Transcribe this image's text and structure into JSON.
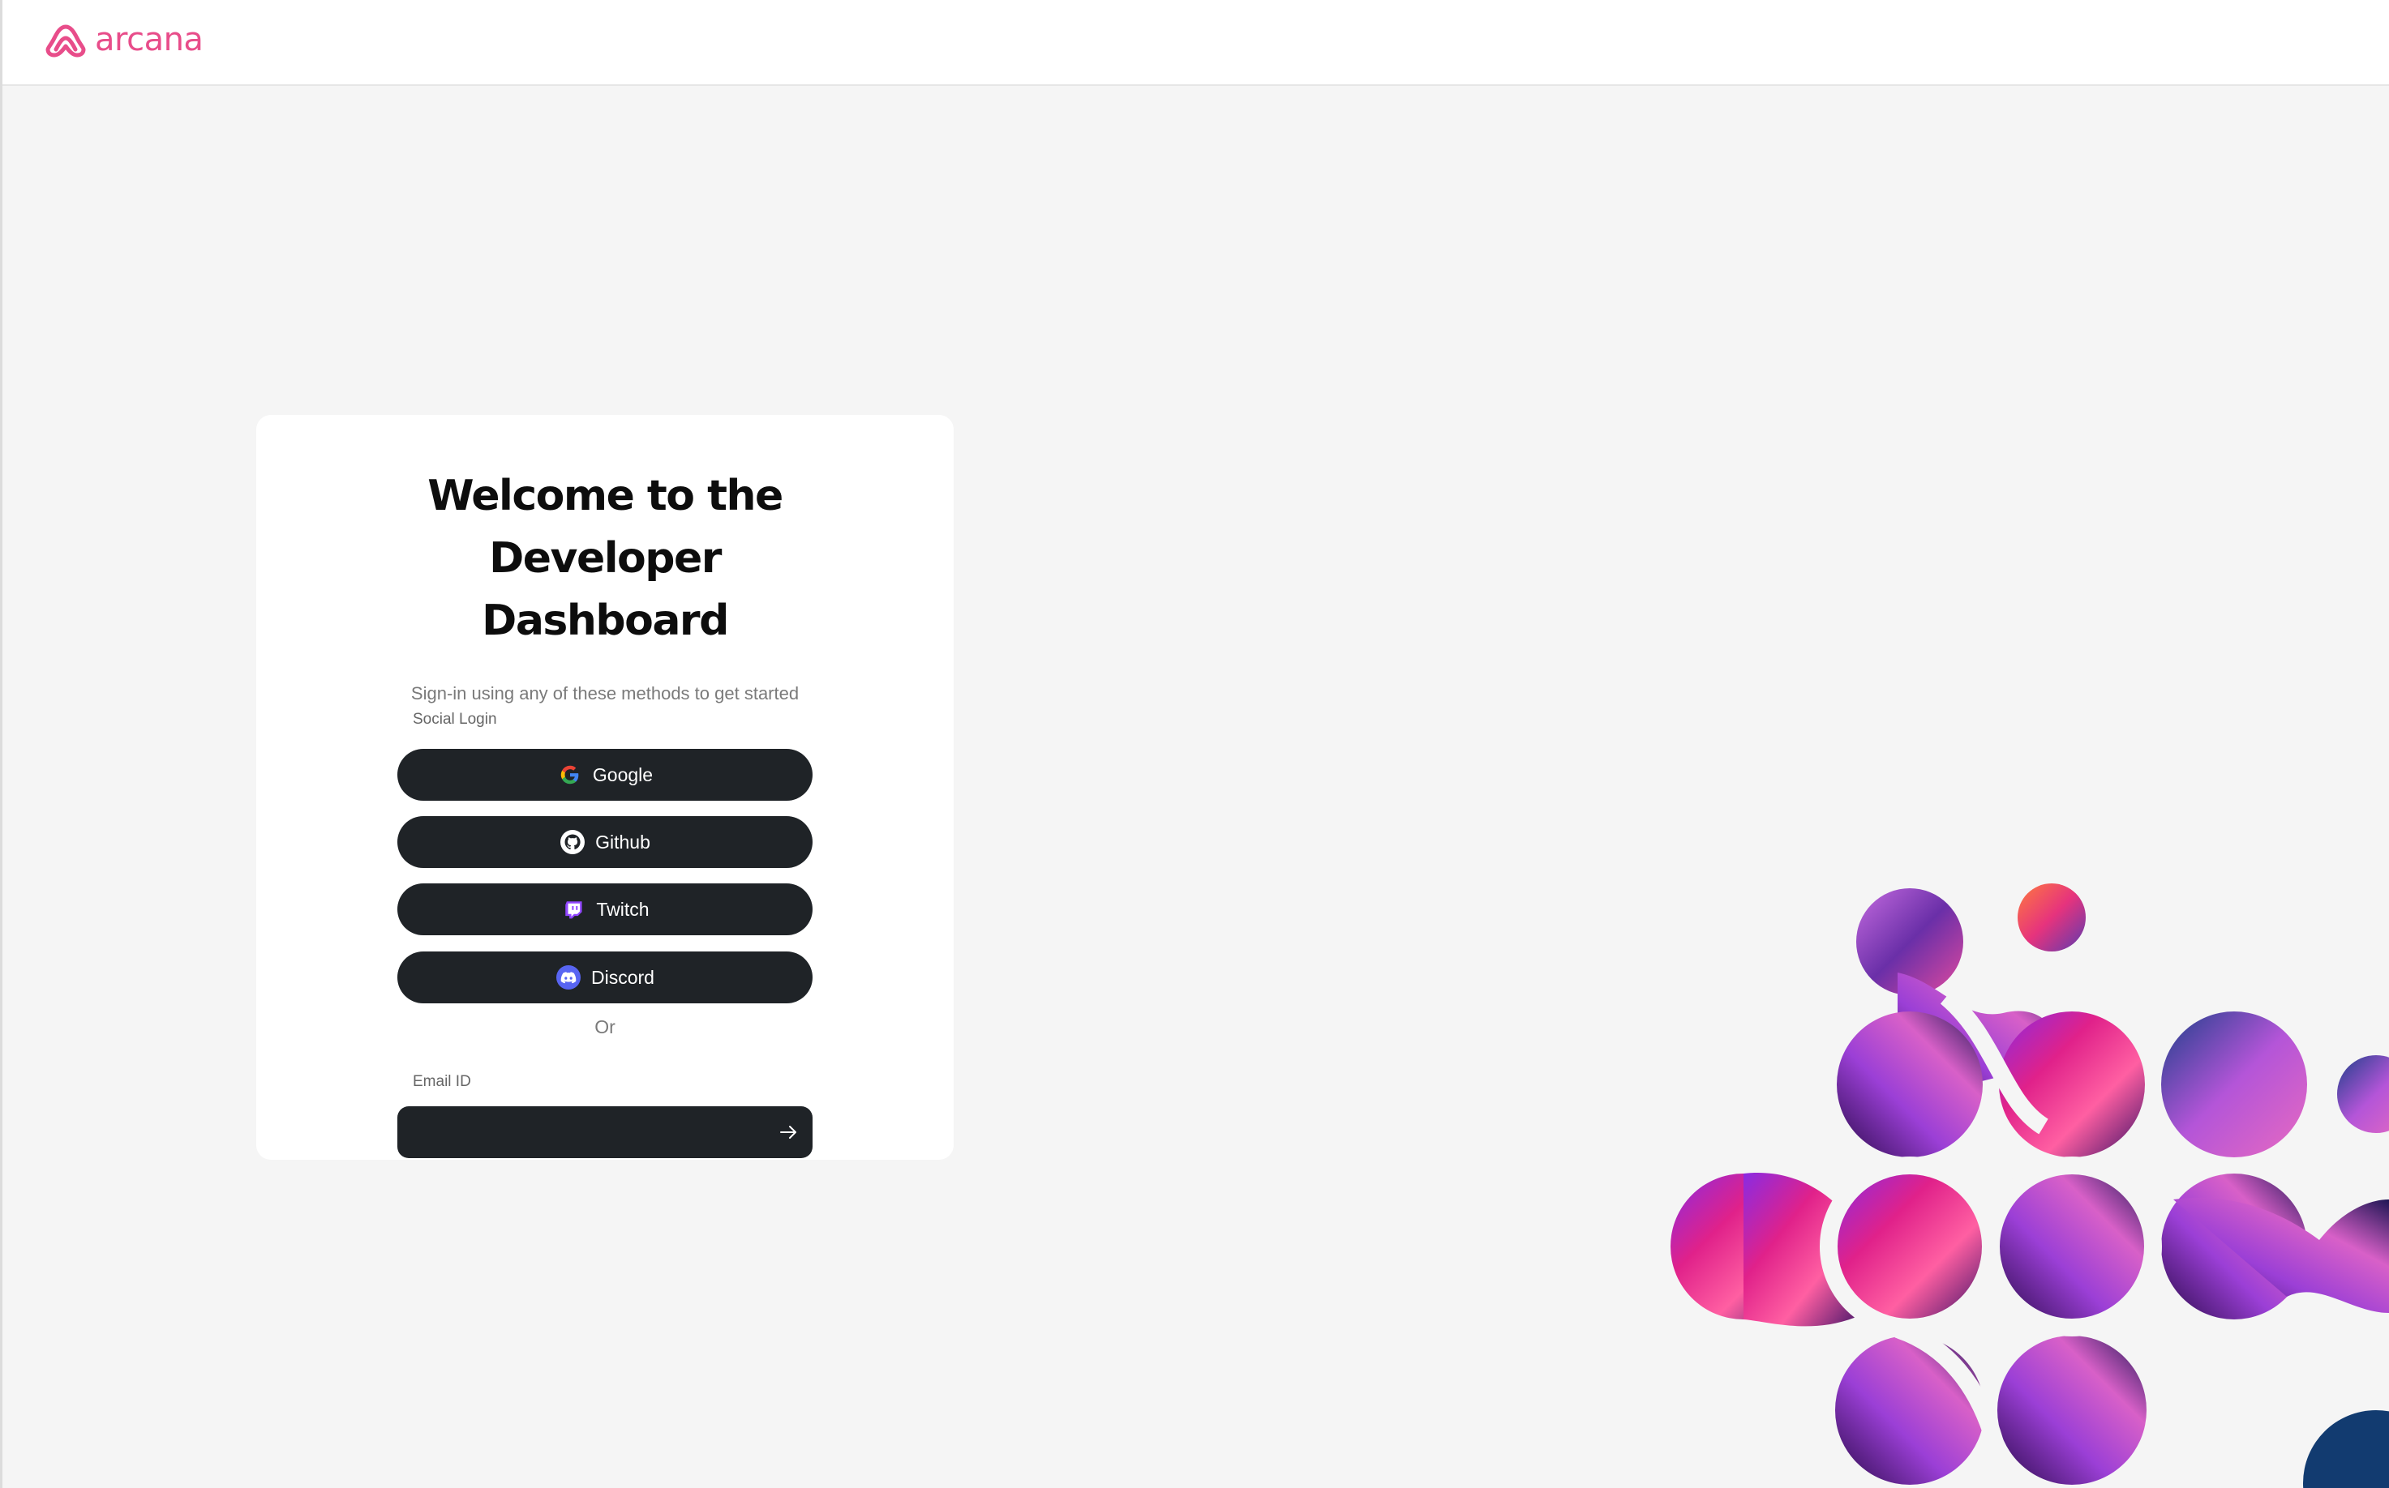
{
  "header": {
    "logo_text": "arcana",
    "brand_color": "#e84d8a"
  },
  "login": {
    "title_line1": "Welcome to the",
    "title_line2": "Developer Dashboard",
    "subtitle": "Sign-in using any of these methods to get started",
    "social_label": "Social Login",
    "buttons": [
      {
        "label": "Google",
        "icon": "google-icon"
      },
      {
        "label": "Github",
        "icon": "github-icon"
      },
      {
        "label": "Twitch",
        "icon": "twitch-icon"
      },
      {
        "label": "Discord",
        "icon": "discord-icon"
      }
    ],
    "or_text": "Or",
    "email_label": "Email ID",
    "email_value": "",
    "email_placeholder": ""
  },
  "colors": {
    "button_bg": "#1f2327",
    "page_bg": "#f5f5f5",
    "card_bg": "#ffffff"
  }
}
